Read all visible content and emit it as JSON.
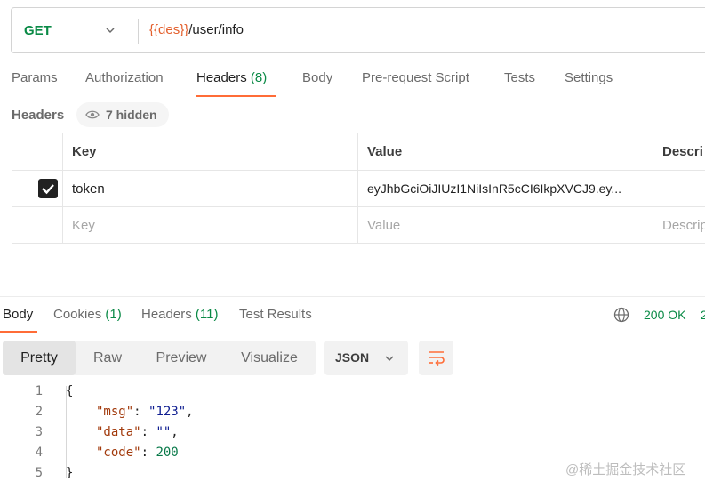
{
  "request": {
    "method": "GET",
    "url_variable": "{{des}}",
    "url_path": "/user/info"
  },
  "request_tabs": [
    {
      "label": "Params",
      "count": ""
    },
    {
      "label": "Authorization",
      "count": ""
    },
    {
      "label": "Headers",
      "count": "(8)"
    },
    {
      "label": "Body",
      "count": ""
    },
    {
      "label": "Pre-request Script",
      "count": ""
    },
    {
      "label": "Tests",
      "count": ""
    },
    {
      "label": "Settings",
      "count": ""
    }
  ],
  "headers_section": {
    "title": "Headers",
    "hidden_label": "7 hidden"
  },
  "headers_table": {
    "columns": [
      "Key",
      "Value",
      "Descri"
    ],
    "rows": [
      {
        "checked": true,
        "key": "token",
        "value": "eyJhbGciOiJIUzI1NiIsInR5cCI6IkpXVCJ9.ey..."
      }
    ],
    "placeholders": {
      "key": "Key",
      "value": "Value",
      "description": "Descrip"
    }
  },
  "response_tabs": [
    {
      "label": "Body",
      "count": ""
    },
    {
      "label": "Cookies",
      "count": "(1)"
    },
    {
      "label": "Headers",
      "count": "(11)"
    },
    {
      "label": "Test Results",
      "count": ""
    }
  ],
  "response_status": {
    "status": "200 OK",
    "extra": "2"
  },
  "view_modes": [
    "Pretty",
    "Raw",
    "Preview",
    "Visualize"
  ],
  "active_view_mode": "Pretty",
  "format": "JSON",
  "code": {
    "line_numbers": [
      "1",
      "2",
      "3",
      "4",
      "5"
    ],
    "open_brace": "{",
    "close_brace": "}",
    "fields": [
      {
        "key": "\"msg\"",
        "value": "\"123\"",
        "type": "string",
        "suffix": ","
      },
      {
        "key": "\"data\"",
        "value": "\"\"",
        "type": "string",
        "suffix": ","
      },
      {
        "key": "\"code\"",
        "value": "200",
        "type": "number",
        "suffix": ""
      }
    ]
  },
  "watermark": "@稀土掘金技术社区",
  "colors": {
    "accent": "#ff6c37",
    "method_get": "#0a8a46",
    "url_variable": "#e35f2c",
    "status_ok": "#0a8a46"
  }
}
